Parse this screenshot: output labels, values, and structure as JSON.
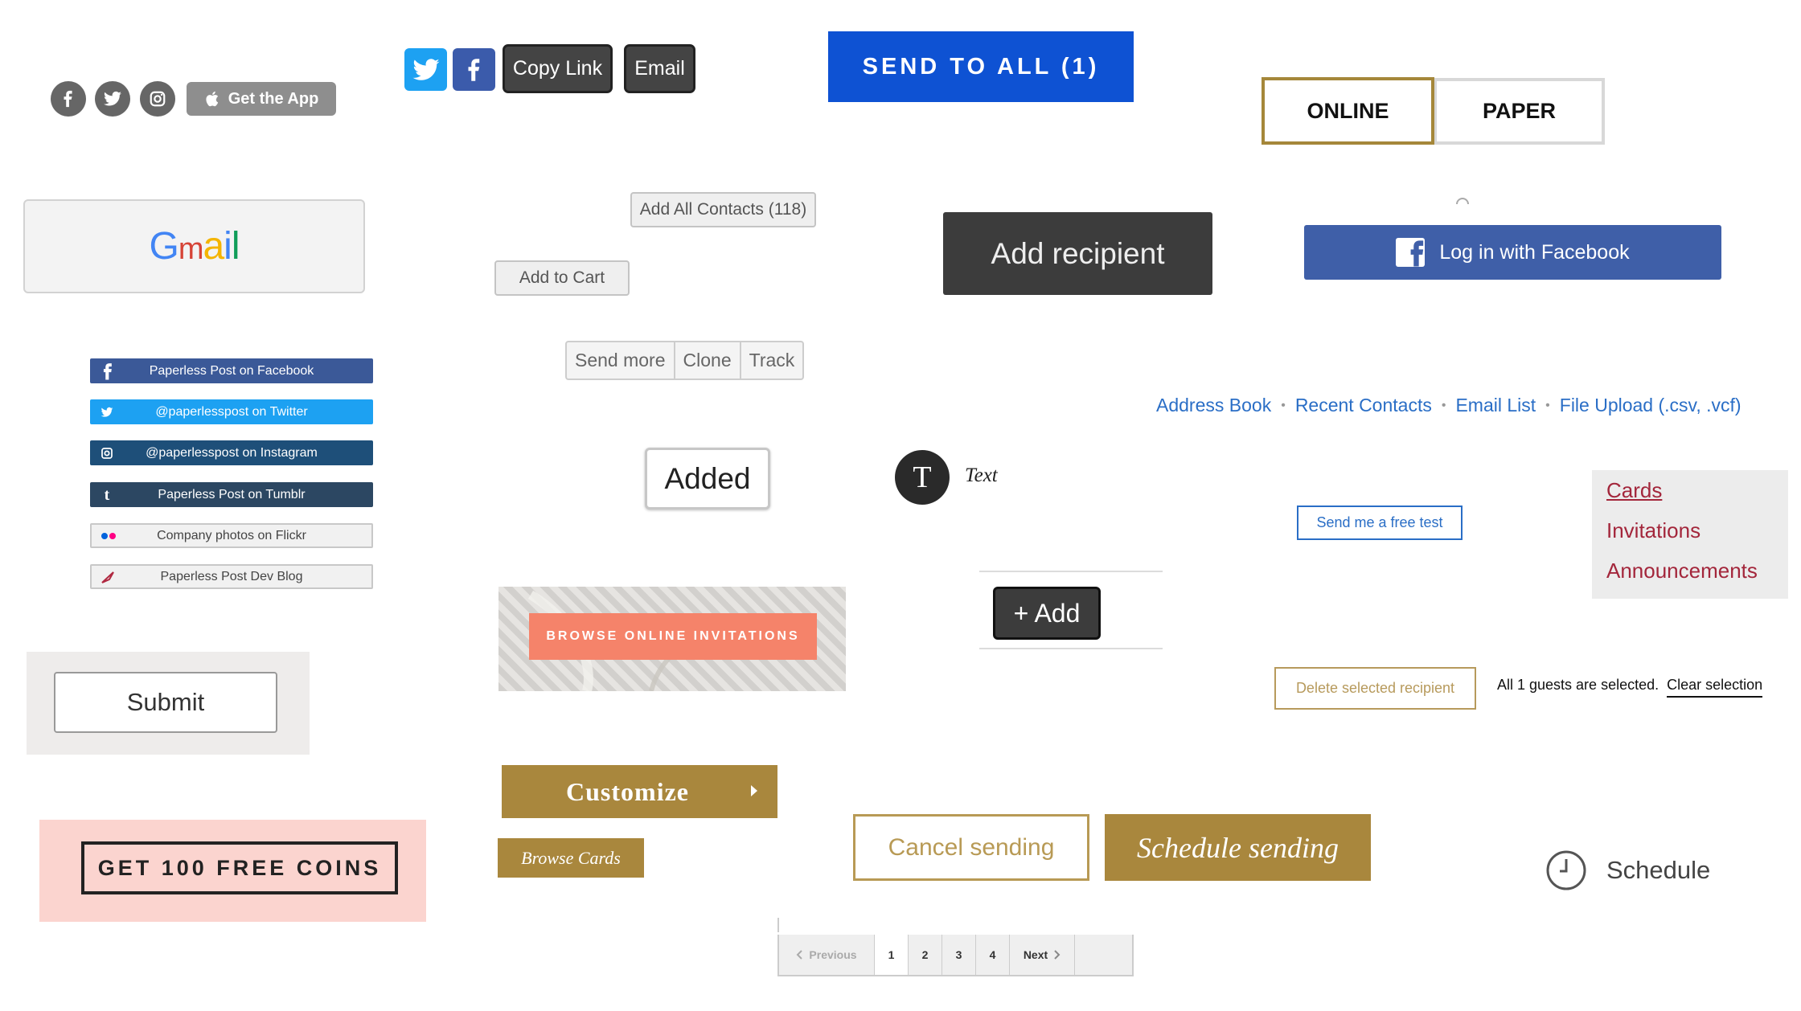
{
  "social_icons": {
    "get_app_label": "Get the App"
  },
  "share": {
    "copy_link": "Copy Link",
    "email": "Email"
  },
  "send_to_all": "SEND TO ALL (1)",
  "format_toggle": {
    "online": "ONLINE",
    "paper": "PAPER"
  },
  "gmail_logo": "GMail",
  "add_all_contacts": "Add All Contacts (118)",
  "add_to_cart": "Add to Cart",
  "add_recipient": "Add recipient",
  "facebook_login": "Log in with Facebook",
  "social_links": [
    "Paperless Post on Facebook",
    "@paperlesspost on Twitter",
    "@paperlesspost on Instagram",
    "Paperless Post on Tumblr",
    "Company photos on Flickr",
    "Paperless Post Dev Blog"
  ],
  "actions": {
    "send_more": "Send more",
    "clone": "Clone",
    "track": "Track"
  },
  "contact_sources": [
    "Address Book",
    "Recent Contacts",
    "Email List",
    "File Upload (.csv, .vcf)"
  ],
  "added": "Added",
  "text_tool": {
    "letter": "T",
    "label": "Text"
  },
  "free_test": "Send me a free test",
  "category_menu": [
    "Cards",
    "Invitations",
    "Announcements"
  ],
  "browse_online": "BROWSE ONLINE INVITATIONS",
  "add_button": "+ Add",
  "delete_recipient": "Delete selected recipient",
  "selection": {
    "status": "All 1 guests are selected.",
    "clear": "Clear selection"
  },
  "submit": "Submit",
  "customize": "Customize",
  "browse_cards": "Browse Cards",
  "free_coins": "GET 100 FREE COINS",
  "cancel_sending": "Cancel sending",
  "schedule_sending": "Schedule sending",
  "schedule": "Schedule",
  "pagination": {
    "previous": "Previous",
    "pages": [
      "1",
      "2",
      "3",
      "4"
    ],
    "next": "Next",
    "current": "1"
  },
  "colors": {
    "brand_blue": "#0e52d3",
    "gold": "#a9873d",
    "facebook": "#3f5fa8",
    "twitter": "#1da1f2",
    "link": "#2a6ec6",
    "salmon": "#f5836a"
  }
}
